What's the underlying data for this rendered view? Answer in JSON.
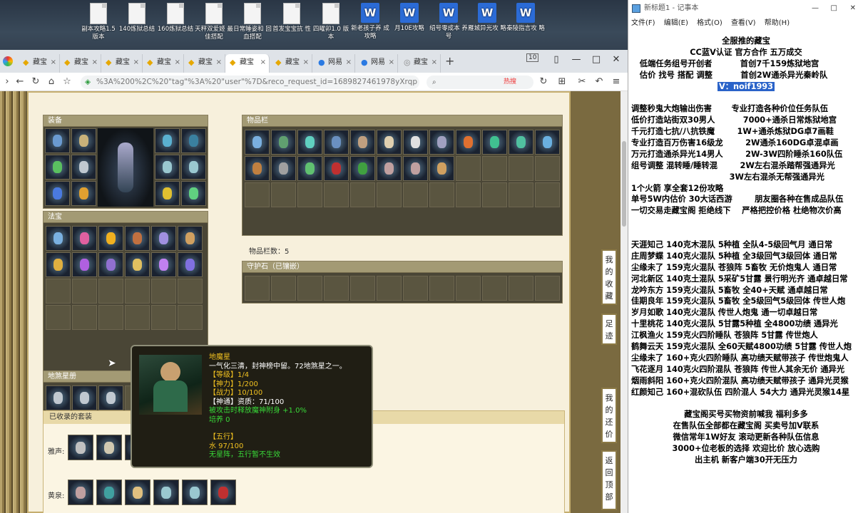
{
  "desktop": {
    "icons": [
      {
        "label": "副本攻略1.5 版本",
        "type": "doc"
      },
      {
        "label": "140炼狱总结",
        "type": "doc"
      },
      {
        "label": "160炼狱总结",
        "type": "doc"
      },
      {
        "label": "天秤双爱姬 最佳搭配",
        "type": "doc"
      },
      {
        "label": "日常睡姿和 回血搭配",
        "type": "doc"
      },
      {
        "label": "首发宝宝抗 性",
        "type": "doc"
      },
      {
        "label": "四曜卯1.0 版本",
        "type": "doc"
      },
      {
        "label": "新老孩子养 成攻略",
        "type": "word"
      },
      {
        "label": "月10E攻略",
        "type": "word"
      },
      {
        "label": "绍号零成本 养号",
        "type": "word"
      },
      {
        "label": "雁城异光攻 略",
        "type": "word"
      },
      {
        "label": "秦陵指言攻 略",
        "type": "word"
      }
    ]
  },
  "browser": {
    "tabs": [
      {
        "label": "藏宝",
        "active": false
      },
      {
        "label": "藏宝",
        "active": false
      },
      {
        "label": "藏宝",
        "active": false
      },
      {
        "label": "藏宝",
        "active": false
      },
      {
        "label": "藏宝",
        "active": false
      },
      {
        "label": "藏宝",
        "active": true
      },
      {
        "label": "藏宝",
        "active": false
      },
      {
        "label": "网易",
        "active": false
      },
      {
        "label": "网易",
        "active": false
      },
      {
        "label": "藏宝",
        "active": false
      }
    ],
    "tab_count": "10",
    "url": "%3A%200%2C%20\"tag\"%3A%20\"user\"%7D&reco_request_id=1689827461978yXrqp",
    "hot_label": "热搜",
    "win_controls": [
      "—",
      "□",
      "✕"
    ]
  },
  "game": {
    "equip_title": "装备",
    "treasure_title": "法宝",
    "star_title": "地煞星册",
    "inventory_title": "物品栏",
    "inventory_count_label": "物品栏数：5",
    "guard_title": "守护石（已镶嵌）",
    "collected_title": "已收录的套装",
    "set_rows": [
      {
        "label": "雅声:"
      },
      {
        "label": "黄泉:"
      }
    ],
    "side_nav": [
      {
        "label": "我的收藏"
      },
      {
        "label": "足迹"
      },
      {
        "label": "我的还价"
      },
      {
        "label": "返回顶部"
      }
    ]
  },
  "tooltip": {
    "name": "地魔星",
    "desc": "一气化三清，封神榜中留。72地煞星之一。",
    "lines": [
      {
        "text": "【等级】1/4",
        "color": "#f0c020"
      },
      {
        "text": "【神力】1/200",
        "color": "#f0c020"
      },
      {
        "text": "【战力】10/100",
        "color": "#f0c020"
      },
      {
        "text": "【神通】资质：71/100",
        "color": "#ffffff"
      },
      {
        "text": "被攻击时释放魔神附身 +1.0%",
        "color": "#38d838"
      },
      {
        "text": "培养 0",
        "color": "#38d838"
      },
      {
        "text": "",
        "color": "#ffffff"
      },
      {
        "text": "【五行】",
        "color": "#f0c020"
      },
      {
        "text": "水 97/100",
        "color": "#f0c020"
      },
      {
        "text": "无星阵，五行暂不生效",
        "color": "#38d838"
      }
    ]
  },
  "notepad": {
    "title": "新标题1 - 记事本",
    "menu": [
      "文件(F)",
      "编辑(E)",
      "格式(O)",
      "查看(V)",
      "帮助(H)"
    ],
    "lines": [
      {
        "text": "全服推的藏宝",
        "align": "center"
      },
      {
        "text": "CC蓝V认证 官方合作 五万成交",
        "align": "center"
      },
      {
        "text": "   低端任务组号开创者          首创7千159炼狱地宫",
        "align": "left"
      },
      {
        "text": "   估价 找号 搭配 调整          首创2W通杀异光秦岭队",
        "align": "left"
      },
      {
        "text": "V：noif1993",
        "align": "center",
        "highlight": true
      },
      {
        "text": "",
        "align": "left"
      },
      {
        "text": "调整秒鬼大炮输出伤害       专业打造各种价位任务队伍",
        "align": "left"
      },
      {
        "text": "低价打造站街双30男人          7000+通杀日常炼狱地宫",
        "align": "left"
      },
      {
        "text": "千元打造七抗/八抗铁魔        1W+通杀炼狱DG卓7画鞋",
        "align": "left"
      },
      {
        "text": "专业打造百万伤害16级龙        2W通杀160DG卓混卓画",
        "align": "left"
      },
      {
        "text": "万元打造通杀异光14男人        2W-3W四阶睡杀160队伍",
        "align": "left"
      },
      {
        "text": "组号调整 混转睡/睡转混        2W左右混杀踏帮强通异光",
        "align": "left"
      },
      {
        "text": "                                   3W左右混杀无帮强通异光",
        "align": "left"
      },
      {
        "text": "1个火箭 享全套12份攻略",
        "align": "left"
      },
      {
        "text": "单号5W内估价 30大话西游        朋友圈各种在售成品队伍",
        "align": "left"
      },
      {
        "text": "一切交易走藏宝阁 拒绝线下    严格把控价格 杜绝物次价高",
        "align": "left"
      },
      {
        "text": "",
        "align": "left"
      },
      {
        "text": "",
        "align": "left"
      },
      {
        "text": "天涯知己 140克木混队 5种植 全队4-5级回气月 通日常",
        "align": "left"
      },
      {
        "text": "庄周梦蝶 140克火混队 5种植 全3级回气3级回体 通日常",
        "align": "left"
      },
      {
        "text": "尘缘未了 159克火混队 苍狼阵 5畜牧 无价炮鬼人 通日常",
        "align": "left"
      },
      {
        "text": "河北新区 140克土混队 5采矿5甘露 景行明光齐 通卓越日常",
        "align": "left"
      },
      {
        "text": "龙吟东方 159克火混队 5畜牧 全40+天赋 通卓越日常",
        "align": "left"
      },
      {
        "text": "佳期良年 159克火混队 5畜牧 全5级回气5级回体 传世人炮",
        "align": "left"
      },
      {
        "text": "岁月如歌 140克火混队 传世人炮鬼 通一切卓越日常",
        "align": "left"
      },
      {
        "text": "十里桃花 140克火混队 5甘露5种植 全4800功绩 通异光",
        "align": "left"
      },
      {
        "text": "江枫渔火 159克火四阶睡队 苍狼阵 5甘露 传世炮人",
        "align": "left"
      },
      {
        "text": "鹤舞云天 159克火混队 全60天赋4800功绩 5甘露 传世人炮",
        "align": "left"
      },
      {
        "text": "尘缘未了 160+克火四阶睡队 高功绩天赋带孩子 传世炮鬼人",
        "align": "left"
      },
      {
        "text": "飞花逐月 140克火四阶混队 苍狼阵 传世人其余无价 通异光",
        "align": "left"
      },
      {
        "text": "烟雨斜阳 160+克火四阶混队 高功绩天赋带孩子 通异光灵猴",
        "align": "left"
      },
      {
        "text": "红颜知己 160+混砍队伍 四阶混人 54大力 通异光灵猴14星",
        "align": "left"
      },
      {
        "text": "",
        "align": "left"
      },
      {
        "text": "藏宝阁买号买物资前喊我 福利多多",
        "align": "center"
      },
      {
        "text": "在售队伍全部都在藏宝阁 买卖号加V联系",
        "align": "center"
      },
      {
        "text": "微信常年1W好友 滚动更新各种队伍信息",
        "align": "center"
      },
      {
        "text": "3000+位老板的选择 欢迎比价 放心选购",
        "align": "center"
      },
      {
        "text": "出主机 新客户端30开无压力",
        "align": "center"
      }
    ]
  }
}
